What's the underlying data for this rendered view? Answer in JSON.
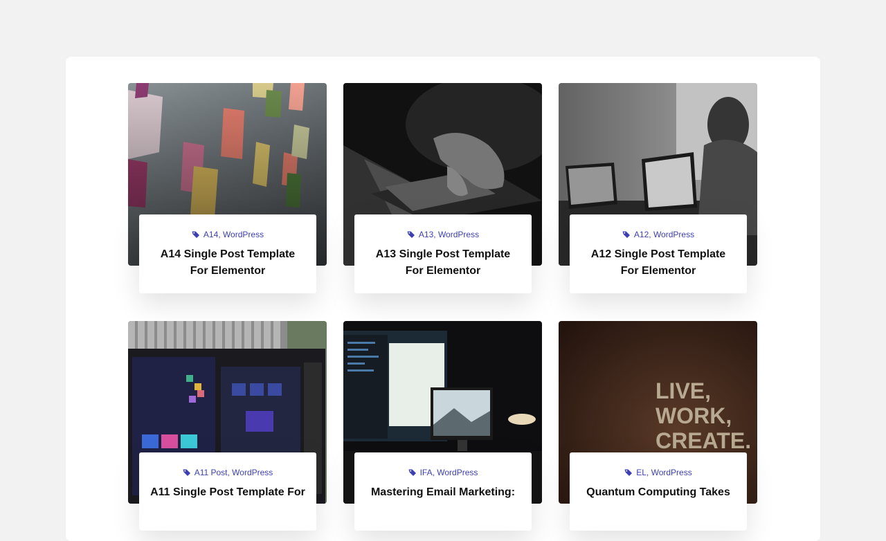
{
  "posts": [
    {
      "tags": "A14, WordPress",
      "title": "A14 Single Post Template For Elementor",
      "image": "sticky-notes-photo"
    },
    {
      "tags": "A13, WordPress",
      "title": "A13 Single Post Template For Elementor",
      "image": "laptop-typing-photo"
    },
    {
      "tags": "A12, WordPress",
      "title": "A12 Single Post Template For Elementor",
      "image": "man-with-laptops-photo"
    },
    {
      "tags": "A11 Post, WordPress",
      "title": "A11 Single Post Template For",
      "image": "monitor-design-photo"
    },
    {
      "tags": "IFA, WordPress",
      "title": "Mastering Email Marketing:",
      "image": "imac-desk-photo"
    },
    {
      "tags": "EL, WordPress",
      "title": "Quantum Computing Takes",
      "image": "live-work-create-wall-photo",
      "wall_text": [
        "LIVE,",
        "WORK,",
        "CREATE."
      ]
    }
  ],
  "colors": {
    "accent": "#3c3fb0",
    "page_bg": "#f2f2f2",
    "panel_bg": "#ffffff"
  }
}
